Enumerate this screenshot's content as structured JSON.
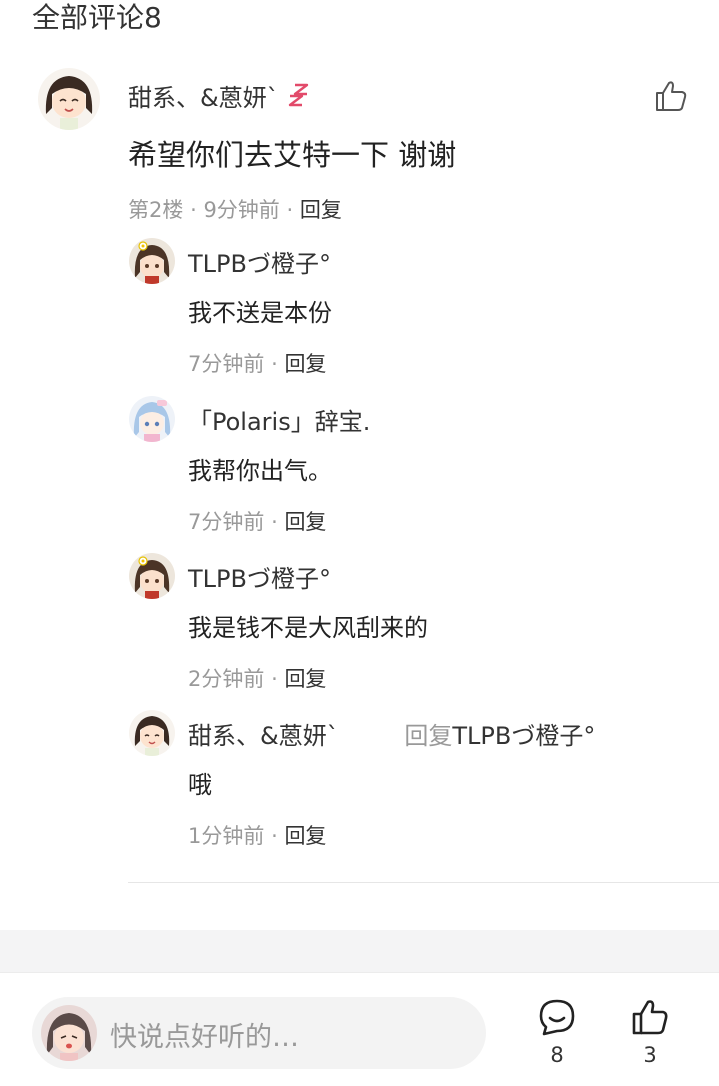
{
  "header": {
    "title": "全部评论8"
  },
  "main_comment": {
    "author": "甜系、&蒽妍`",
    "text": "希望你们去艾特一下 谢谢",
    "floor": "第2楼",
    "time": "9分钟前",
    "reply_label": "回复",
    "separator": "·"
  },
  "replies": [
    {
      "author": "TLPBづ橙子°",
      "text": "我不送是本份",
      "time": "7分钟前",
      "reply_label": "回复"
    },
    {
      "author": "「Polaris」辞宝.",
      "text": "我帮你出气。",
      "time": "7分钟前",
      "reply_label": "回复"
    },
    {
      "author": "TLPBづ橙子°",
      "text": "我是钱不是大风刮来的",
      "time": "2分钟前",
      "reply_label": "回复"
    },
    {
      "author": "甜系、&蒽妍`",
      "reply_prefix": "回复",
      "reply_target": "TLPBづ橙子°",
      "text": "哦",
      "time": "1分钟前",
      "reply_label": "回复"
    }
  ],
  "bottom_bar": {
    "placeholder": "快说点好听的…",
    "comment_count": "8",
    "like_count": "3"
  },
  "colors": {
    "meta_gray": "#999999",
    "text_dark": "#222222",
    "band_gray": "#f4f4f5"
  },
  "icons": {
    "like": "thumbs-up-icon",
    "comment": "comment-bubble-icon",
    "badge": "sleep-zz-icon"
  }
}
